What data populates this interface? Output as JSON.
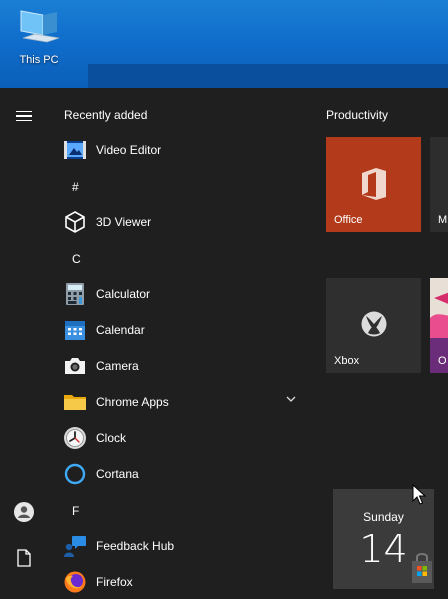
{
  "desktop": {
    "icon_label": "This PC"
  },
  "start_menu": {
    "list_header": "Recently added",
    "apps": [
      {
        "name": "Video Editor",
        "icon": "video-editor-icon"
      },
      {
        "name": "3D Viewer",
        "icon": "cube-icon"
      },
      {
        "name": "Calculator",
        "icon": "calculator-icon"
      },
      {
        "name": "Calendar",
        "icon": "calendar-icon"
      },
      {
        "name": "Camera",
        "icon": "camera-icon"
      },
      {
        "name": "Chrome Apps",
        "icon": "folder-icon"
      },
      {
        "name": "Clock",
        "icon": "clock-icon"
      },
      {
        "name": "Cortana",
        "icon": "cortana-icon"
      },
      {
        "name": "Feedback Hub",
        "icon": "feedback-icon"
      },
      {
        "name": "Firefox",
        "icon": "firefox-icon"
      }
    ],
    "letters": [
      "#",
      "C",
      "F"
    ]
  },
  "tiles": {
    "group_title": "Productivity",
    "office_label": "Office",
    "m_label": "M",
    "xbox_label": "Xbox",
    "o_label": "O",
    "calendar_day": "Sunday",
    "calendar_date": "14"
  },
  "colors": {
    "office": "#b33a1a",
    "accent": "#0b5fb8"
  }
}
